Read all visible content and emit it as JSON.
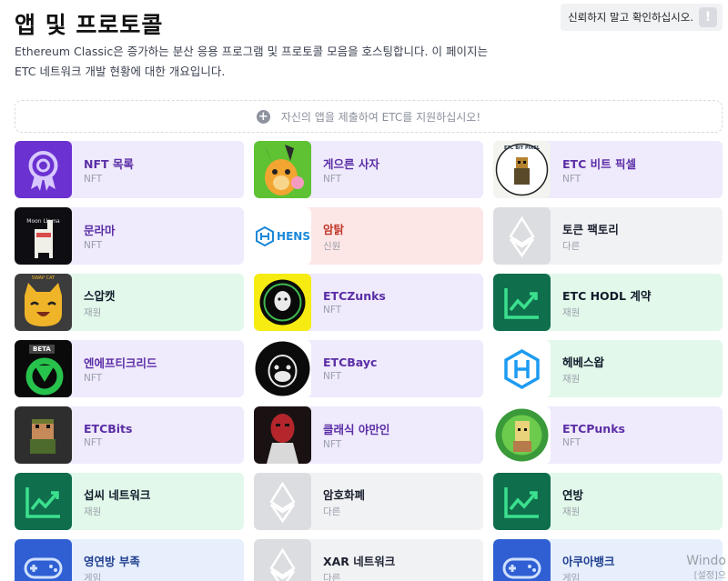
{
  "page": {
    "title": "앱 및 프로토콜",
    "description": "Ethereum Classic은 증가하는 분산 응용 프로그램 및 프로토콜 모음을 호스팅합니다. 이 페이지는 ETC 네트워크 개발 현황에 대한 개요입니다.",
    "untrusted_notice": "신뢰하지 말고 확인하십시오.",
    "submit_label": "자신의 앱을 제출하여 ETC를 지원하십시오!"
  },
  "apps": [
    {
      "title": "NFT 목록",
      "tag": "NFT",
      "icon": "ribbon-badge-icon"
    },
    {
      "title": "게으른 사자",
      "tag": "NFT",
      "icon": "lazy-lion-icon"
    },
    {
      "title": "ETC 비트 픽셀",
      "tag": "NFT",
      "icon": "etc-bit-pixel-icon",
      "thumb_text": "ETC BIT PIXEL"
    },
    {
      "title": "문라마",
      "tag": "NFT",
      "icon": "moon-llama-icon",
      "thumb_text": "Moon Llama"
    },
    {
      "title": "암탉",
      "tag": "신원",
      "icon": "hens-logo-icon",
      "thumb_text": "HENS"
    },
    {
      "title": "토큰 팩토리",
      "tag": "다른",
      "icon": "ethereum-diamond-icon"
    },
    {
      "title": "스압캣",
      "tag": "재원",
      "icon": "swap-cat-icon",
      "thumb_text": "SWAP CAT"
    },
    {
      "title": "ETCZunks",
      "tag": "NFT",
      "icon": "etczunks-icon"
    },
    {
      "title": "ETC HODL 계약",
      "tag": "재원",
      "icon": "chart-up-icon"
    },
    {
      "title": "엔에프티크리드",
      "tag": "NFT",
      "icon": "nftcreed-icon",
      "thumb_text": "BETA"
    },
    {
      "title": "ETCBayc",
      "tag": "NFT",
      "icon": "etcbayc-ape-icon"
    },
    {
      "title": "헤베스왑",
      "tag": "재원",
      "icon": "hebeswap-icon"
    },
    {
      "title": "ETCBits",
      "tag": "NFT",
      "icon": "etcbits-icon"
    },
    {
      "title": "클래식 야만인",
      "tag": "NFT",
      "icon": "classic-barbarian-icon"
    },
    {
      "title": "ETCPunks",
      "tag": "NFT",
      "icon": "etcpunks-icon"
    },
    {
      "title": "섭씨 네트워크",
      "tag": "재원",
      "icon": "chart-up-icon"
    },
    {
      "title": "암호화폐",
      "tag": "다른",
      "icon": "ethereum-diamond-icon"
    },
    {
      "title": "연방",
      "tag": "재원",
      "icon": "chart-up-icon"
    },
    {
      "title": "영연방 부족",
      "tag": "게임",
      "icon": "gamepad-icon"
    },
    {
      "title": "XAR 네트워크",
      "tag": "다른",
      "icon": "ethereum-diamond-icon"
    },
    {
      "title": "아쿠아뱅크",
      "tag": "게임",
      "icon": "gamepad-icon"
    }
  ],
  "watermark": {
    "line1": "Windo",
    "line2": "[설정]으"
  },
  "colors": {
    "nft_bg": "#efeafc",
    "fund_bg": "#e2f8ea",
    "other_bg": "#f1f2f4",
    "scam_bg": "#fde6e6",
    "game_bg": "#e7effd",
    "purple": "#5e2fb3",
    "green": "#0c6b4b",
    "blue": "#2f5fd3"
  }
}
